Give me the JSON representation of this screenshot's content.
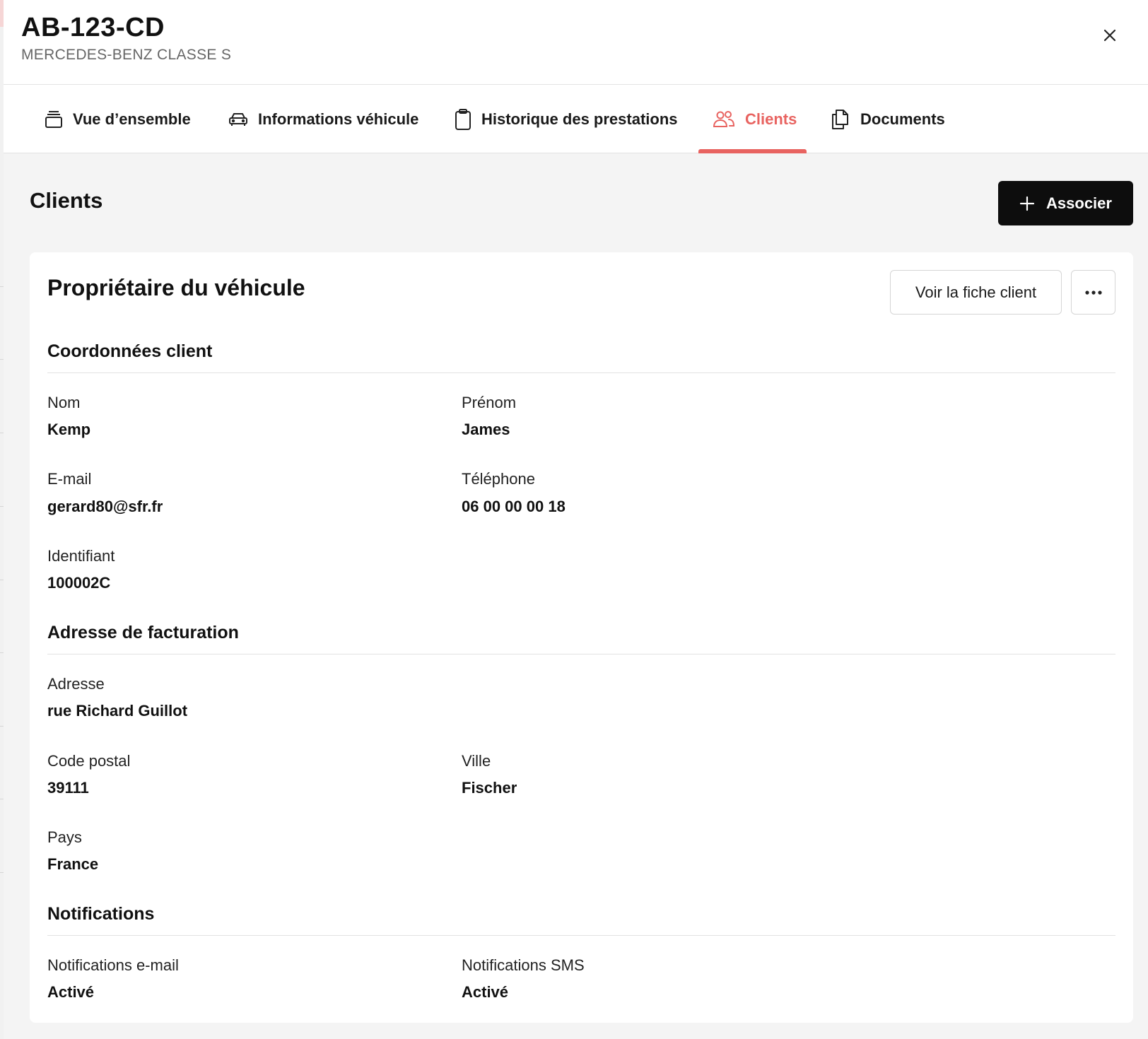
{
  "header": {
    "plate": "AB-123-CD",
    "model": "MERCEDES-BENZ CLASSE S"
  },
  "tabs": [
    {
      "label": "Vue d’ensemble",
      "icon": "box-icon"
    },
    {
      "label": "Informations véhicule",
      "icon": "car-icon"
    },
    {
      "label": "Historique des prestations",
      "icon": "clipboard-icon"
    },
    {
      "label": "Clients",
      "icon": "users-icon",
      "active": true
    },
    {
      "label": "Documents",
      "icon": "documents-icon"
    }
  ],
  "main": {
    "title": "Clients",
    "associate_label": "Associer"
  },
  "card": {
    "title": "Propriétaire du véhicule",
    "view_client_label": "Voir la fiche client",
    "sections": {
      "contact": {
        "title": "Coordonnées client",
        "nom_label": "Nom",
        "nom_value": "Kemp",
        "prenom_label": "Prénom",
        "prenom_value": "James",
        "email_label": "E-mail",
        "email_value": "gerard80@sfr.fr",
        "phone_label": "Téléphone",
        "phone_value": "06 00 00 00 18",
        "id_label": "Identifiant",
        "id_value": "100002C"
      },
      "billing": {
        "title": "Adresse de facturation",
        "address_label": "Adresse",
        "address_value": "rue Richard Guillot",
        "postal_label": "Code postal",
        "postal_value": "39111",
        "city_label": "Ville",
        "city_value": "Fischer",
        "country_label": "Pays",
        "country_value": "France"
      },
      "notifications": {
        "title": "Notifications",
        "email_label": "Notifications e-mail",
        "email_value": "Activé",
        "sms_label": "Notifications SMS",
        "sms_value": "Activé"
      }
    }
  },
  "colors": {
    "accent": "#e86360",
    "primary_button": "#0d0d0d",
    "page_background": "#f4f4f4"
  }
}
